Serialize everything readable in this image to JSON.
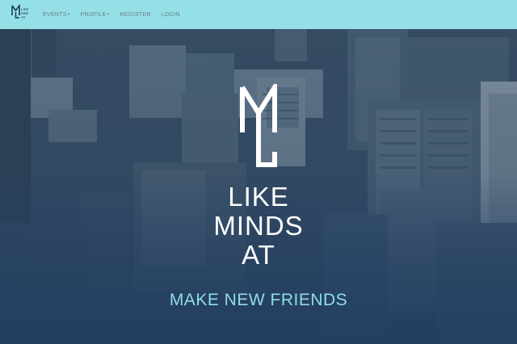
{
  "navbar": {
    "logo_text": "LIKE MINDS AT",
    "items": [
      {
        "label": "EVENTS",
        "has_dropdown": true
      },
      {
        "label": "PROFILE",
        "has_dropdown": true
      },
      {
        "label": "REGISTER",
        "has_dropdown": false
      },
      {
        "label": "LOGIN",
        "has_dropdown": false
      }
    ],
    "caret": "▾"
  },
  "hero": {
    "title_lines": [
      "LIKE",
      "MINDS",
      "AT"
    ],
    "tagline": "MAKE NEW FRIENDS"
  },
  "colors": {
    "navbar_bg": "#95e0e6",
    "nav_text": "#6a7f89",
    "hero_text": "#ffffff",
    "tagline": "#8fdde6",
    "hero_bg": "#25405f"
  }
}
